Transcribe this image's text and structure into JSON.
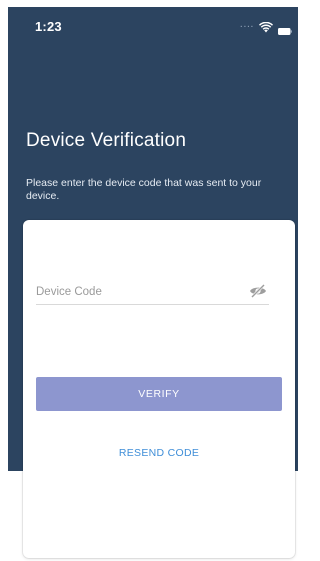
{
  "status_bar": {
    "time": "1:23",
    "signal_dots": "....",
    "wifi_icon": "wifi-icon",
    "battery_icon": "battery-icon"
  },
  "header": {
    "title": "Device Verification",
    "subtitle": "Please enter the device code that was sent to your device."
  },
  "form": {
    "device_code": {
      "value": "",
      "placeholder": "Device Code",
      "toggle_icon": "eye-slash-icon"
    },
    "verify_label": "VERIFY",
    "resend_label": "RESEND CODE"
  },
  "colors": {
    "header_background": "#2c4460",
    "verify_button": "#8d96cf",
    "resend_link": "#3f8ed8"
  }
}
